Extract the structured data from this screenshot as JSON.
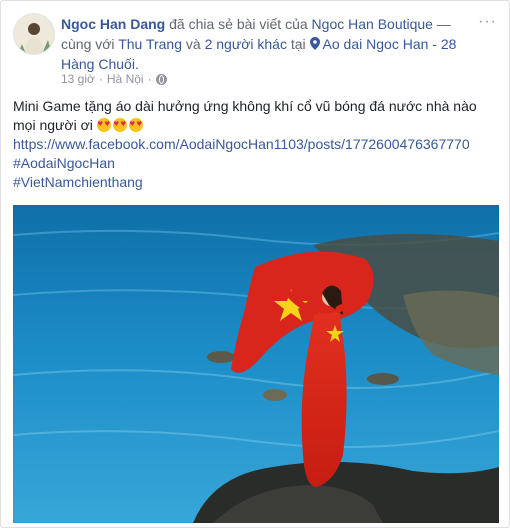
{
  "post": {
    "author": "Ngoc Han Dang",
    "shared_text": " đã chia sẻ bài viết của ",
    "page_name": "Ngoc Han Boutique",
    "with_text": " — cùng với ",
    "tagged_friend": "Thu Trang",
    "and_text": " và ",
    "others": "2 người khác",
    "at_text": " tại ",
    "place": "Ao dai Ngoc Han - 28 Hàng Chuối.",
    "time": "13 giờ",
    "separator": "·",
    "location": "Hà Nội",
    "separator2": "·",
    "privacy_icon": "globe-icon",
    "more_label": "···"
  },
  "content": {
    "line1": "Mini Game tặng áo dài hưởng ứng không khí cổ vũ bóng đá nước nhà nào",
    "line2": "mọi người ơi ",
    "emoji_icon": "heart-eyes-emoji",
    "link": "https://www.facebook.com/AodaiNgocHan1103/posts/1772600476367770",
    "hashtag1": "#AodaiNgocHan",
    "hashtag2": "#VietNamchienthang"
  },
  "colors": {
    "link": "#385898",
    "meta": "#90949c",
    "text": "#1d2129",
    "flag_red": "#d8261c",
    "flag_star": "#f7d21a",
    "sea": "#1b7fb8"
  }
}
